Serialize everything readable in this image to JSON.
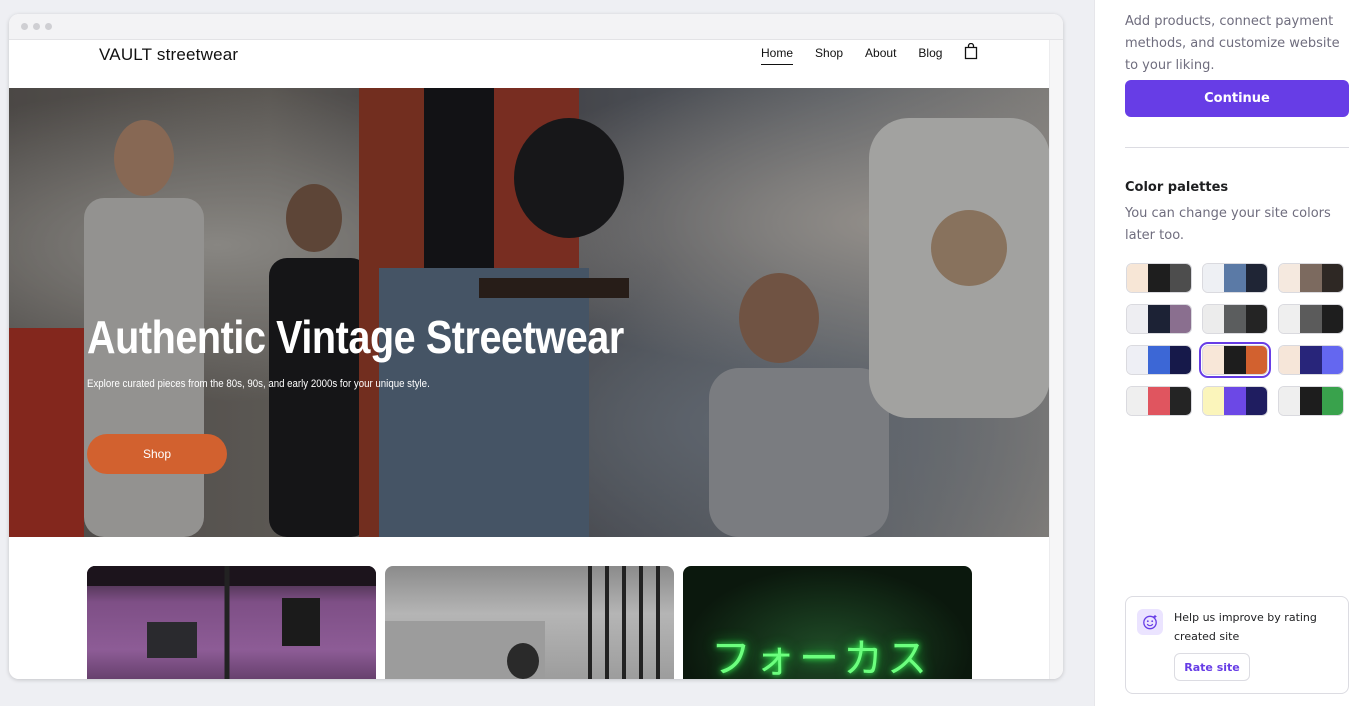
{
  "site": {
    "logo": "VAULT streetwear",
    "nav": [
      {
        "label": "Home",
        "active": true
      },
      {
        "label": "Shop",
        "active": false
      },
      {
        "label": "About",
        "active": false
      },
      {
        "label": "Blog",
        "active": false
      }
    ],
    "cart_icon": "shopping-bag-icon",
    "hero": {
      "title": "Authentic Vintage Streetwear",
      "subtitle": "Explore curated pieces from the 80s, 90s, and early 2000s for your unique style.",
      "button_label": "Shop",
      "button_color": "#d2612f"
    },
    "cards": [
      {
        "name": "card-storefront-image"
      },
      {
        "name": "card-street-image"
      },
      {
        "name": "card-neon-sign-image",
        "sign_text": "フォーカス"
      }
    ]
  },
  "panel": {
    "intro": "Add products, connect payment methods, and customize website to your liking.",
    "continue_label": "Continue",
    "accent_color": "#673de6",
    "palettes_title": "Color palettes",
    "palettes_desc": "You can change your site colors later too.",
    "palettes": [
      {
        "colors": [
          "#f7e6d6",
          "#1e1e1e",
          "#4d4d4d"
        ],
        "selected": false
      },
      {
        "colors": [
          "#eef0f4",
          "#5b7aa6",
          "#1f2535"
        ],
        "selected": false
      },
      {
        "colors": [
          "#f5e9df",
          "#7c6a5f",
          "#2e2824"
        ],
        "selected": false
      },
      {
        "colors": [
          "#eeeef2",
          "#1c2235",
          "#8a6f8f"
        ],
        "selected": false
      },
      {
        "colors": [
          "#ececec",
          "#5b5d5e",
          "#242424"
        ],
        "selected": false
      },
      {
        "colors": [
          "#efefef",
          "#5b5b5b",
          "#1e1e1e"
        ],
        "selected": false
      },
      {
        "colors": [
          "#eeeff5",
          "#3c67d6",
          "#16194a"
        ],
        "selected": false
      },
      {
        "colors": [
          "#f8e7d8",
          "#1d1d1d",
          "#d2612f"
        ],
        "selected": true
      },
      {
        "colors": [
          "#f6e6d9",
          "#28257a",
          "#6467f0"
        ],
        "selected": false
      },
      {
        "colors": [
          "#efefef",
          "#e0555f",
          "#242424"
        ],
        "selected": false
      },
      {
        "colors": [
          "#fbf5bb",
          "#6c48e6",
          "#1f1d60"
        ],
        "selected": false
      },
      {
        "colors": [
          "#efefef",
          "#1d1d1d",
          "#39a24c"
        ],
        "selected": false
      }
    ],
    "rate": {
      "icon": "smiley-sparkle-icon",
      "text": "Help us improve by rating created site",
      "button_label": "Rate site"
    }
  }
}
